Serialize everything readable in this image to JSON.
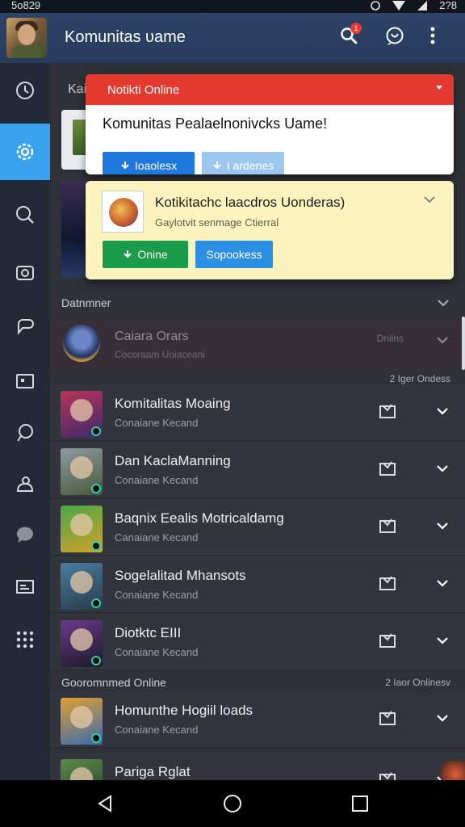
{
  "status_bar": {
    "time": "5o829",
    "right_text": "2?8"
  },
  "app_bar": {
    "title": "Komunitas ᴜame",
    "notification_count": "1"
  },
  "rail": {
    "icons": [
      "clock-icon",
      "settings-icon",
      "search-icon",
      "camera-icon",
      "chat-icon",
      "card-icon",
      "bubble-icon",
      "person-icon",
      "comment-icon",
      "folder-icon",
      "apps-icon"
    ],
    "active_index": 1
  },
  "background_header": "Kai",
  "notification_red": {
    "header": "Notikti Online",
    "message": "Komunitas Pealaelnonivcks Uame!",
    "button1": "Ioaolesx",
    "button2": "I ardenes"
  },
  "notification_yellow": {
    "title": "Kotikitachc laacdros Uonderas)",
    "subtitle": "Gaylotvit senmage Ctierral",
    "button1": "Onine",
    "button2": "Sopookess"
  },
  "section1": {
    "label": "Datnmner"
  },
  "featured": {
    "name": "Caiara Orars",
    "subtitle": "Cocoraam Uoiaceani",
    "status": "Dnilns"
  },
  "section1_right": "2 Iger Ondess",
  "rows": [
    {
      "name": "Komitalitas Moaing",
      "sub": "Conaiane Kecand",
      "colors": [
        "#b8345a",
        "#3c2a6b"
      ]
    },
    {
      "name": "Dan KaclaManning",
      "sub": "Conaiane Kecand",
      "colors": [
        "#8c9aa0",
        "#4a5a3a"
      ]
    },
    {
      "name": "Baqnix Eealis Motricaldamg",
      "sub": "Canaiane Kecand",
      "colors": [
        "#4aa84a",
        "#d3a02a"
      ]
    },
    {
      "name": "Sogelalitad Mhansots",
      "sub": "Conaiane Kecand",
      "colors": [
        "#4a7ea0",
        "#2a3a4a"
      ]
    },
    {
      "name": "Diotktc EIII",
      "sub": "Conaiane Kecand",
      "colors": [
        "#6a3a8a",
        "#1a1a2a"
      ]
    }
  ],
  "section2": {
    "label": "Gooromnmed Online",
    "right": "2 Iaor Onlinesv"
  },
  "rows2": [
    {
      "name": "Homunthe Hogiil loads",
      "sub": "Conaiane Kecand",
      "colors": [
        "#e0a030",
        "#3a6ab0"
      ]
    },
    {
      "name": "Pariga Rglat",
      "sub": "",
      "colors": [
        "#5a8a4a",
        "#2a3a2a"
      ]
    }
  ]
}
